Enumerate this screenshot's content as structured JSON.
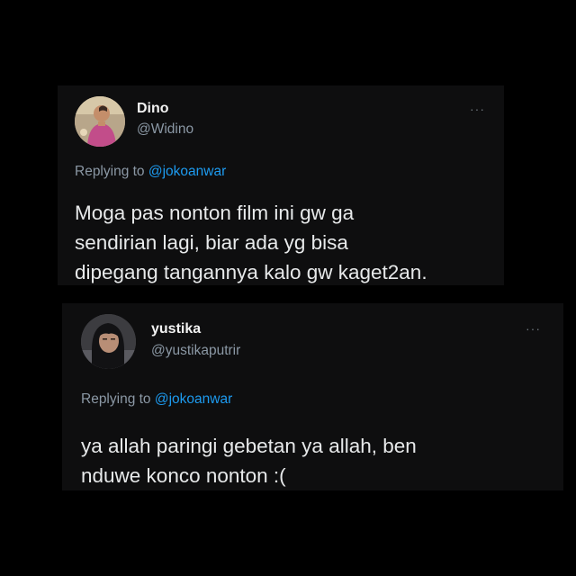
{
  "tweets": [
    {
      "name": "Dino",
      "handle": "@Widino",
      "more_label": "···",
      "reply_prefix": "Replying to",
      "reply_mention": "@jokoanwar",
      "text_lines": [
        "Moga pas nonton film ini gw ga",
        "sendirian lagi, biar ada yg bisa",
        "dipegang tangannya kalo gw kaget2an."
      ]
    },
    {
      "name": "yustika",
      "handle": "@yustikaputrir",
      "more_label": "···",
      "reply_prefix": "Replying to",
      "reply_mention": "@jokoanwar",
      "text_lines": [
        "ya allah paringi gebetan ya allah, ben",
        "nduwe konco nonton :("
      ]
    }
  ],
  "colors": {
    "background": "#000000",
    "card": "#0e0e0f",
    "text": "#e7e9ea",
    "secondary_text": "#8b98a5",
    "mention": "#1d9bf0"
  },
  "icons": {
    "more": "more-dots-icon",
    "avatar_1": "avatar-photo",
    "avatar_2": "avatar-photo"
  }
}
